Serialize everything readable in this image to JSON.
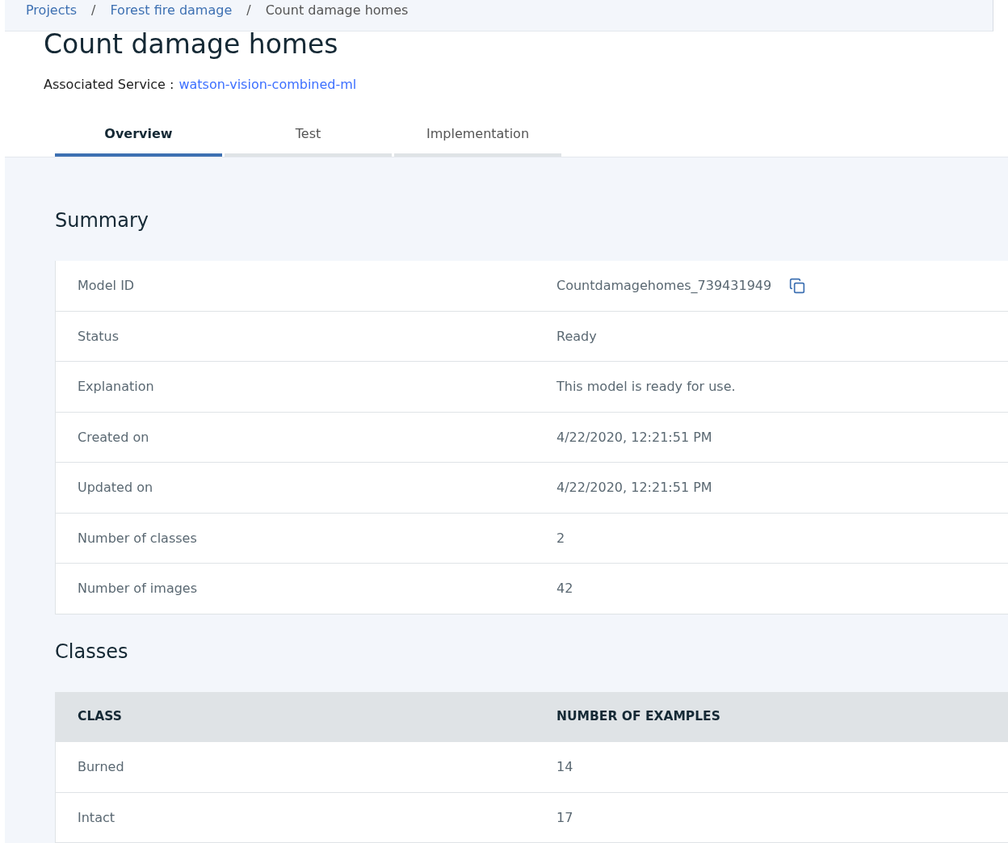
{
  "breadcrumbs": [
    {
      "label": "Projects",
      "link": true
    },
    {
      "label": "Forest fire damage",
      "link": true
    },
    {
      "label": "Count damage homes",
      "link": false
    }
  ],
  "breadcrumb_separator": "/",
  "title": "Count damage homes",
  "service": {
    "label": "Associated Service :",
    "value": "watson-vision-combined-ml"
  },
  "tabs": [
    {
      "label": "Overview",
      "selected": true
    },
    {
      "label": "Test",
      "selected": false
    },
    {
      "label": "Implementation",
      "selected": false
    }
  ],
  "summary": {
    "title": "Summary",
    "rows": [
      {
        "label": "Model ID",
        "value": "Countdamagehomes_739431949",
        "copyable": true
      },
      {
        "label": "Status",
        "value": "Ready",
        "copyable": false
      },
      {
        "label": "Explanation",
        "value": "This model is ready for use.",
        "copyable": false
      },
      {
        "label": "Created on",
        "value": "4/22/2020, 12:21:51 PM",
        "copyable": false
      },
      {
        "label": "Updated on",
        "value": "4/22/2020, 12:21:51 PM",
        "copyable": false
      },
      {
        "label": "Number of classes",
        "value": "2",
        "copyable": false
      },
      {
        "label": "Number of images",
        "value": "42",
        "copyable": false
      }
    ]
  },
  "classes": {
    "title": "Classes",
    "columns": [
      "CLASS",
      "NUMBER OF EXAMPLES"
    ],
    "rows": [
      [
        "Burned",
        "14"
      ],
      [
        "Intact",
        "17"
      ]
    ]
  }
}
